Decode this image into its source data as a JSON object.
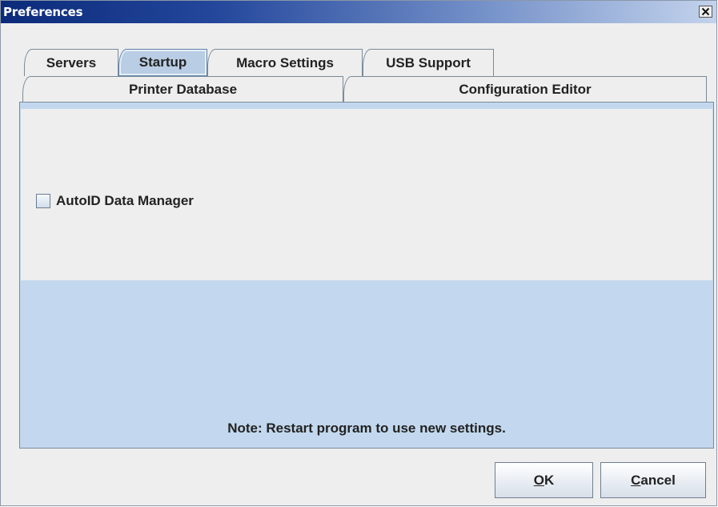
{
  "window": {
    "title": "Preferences"
  },
  "tabs": {
    "row_top": [
      {
        "label": "Servers"
      },
      {
        "label": "Startup",
        "selected": true
      },
      {
        "label": "Macro Settings"
      },
      {
        "label": "USB Support"
      }
    ],
    "row_bottom": [
      {
        "label": "Printer Database"
      },
      {
        "label": "Configuration Editor"
      }
    ]
  },
  "startup_panel": {
    "checkbox_label": "AutoID Data Manager",
    "checkbox_checked": false,
    "note": "Note: Restart program to use new settings."
  },
  "buttons": {
    "ok": {
      "mnemonic": "O",
      "rest": "K"
    },
    "cancel": {
      "mnemonic": "C",
      "rest": "ancel"
    }
  },
  "colors": {
    "selected_tab": "#b9cde4",
    "panel_lower": "#c3d8ee",
    "title_gradient_start": "#0b2a7a"
  },
  "icons": {
    "close": "close-icon"
  }
}
